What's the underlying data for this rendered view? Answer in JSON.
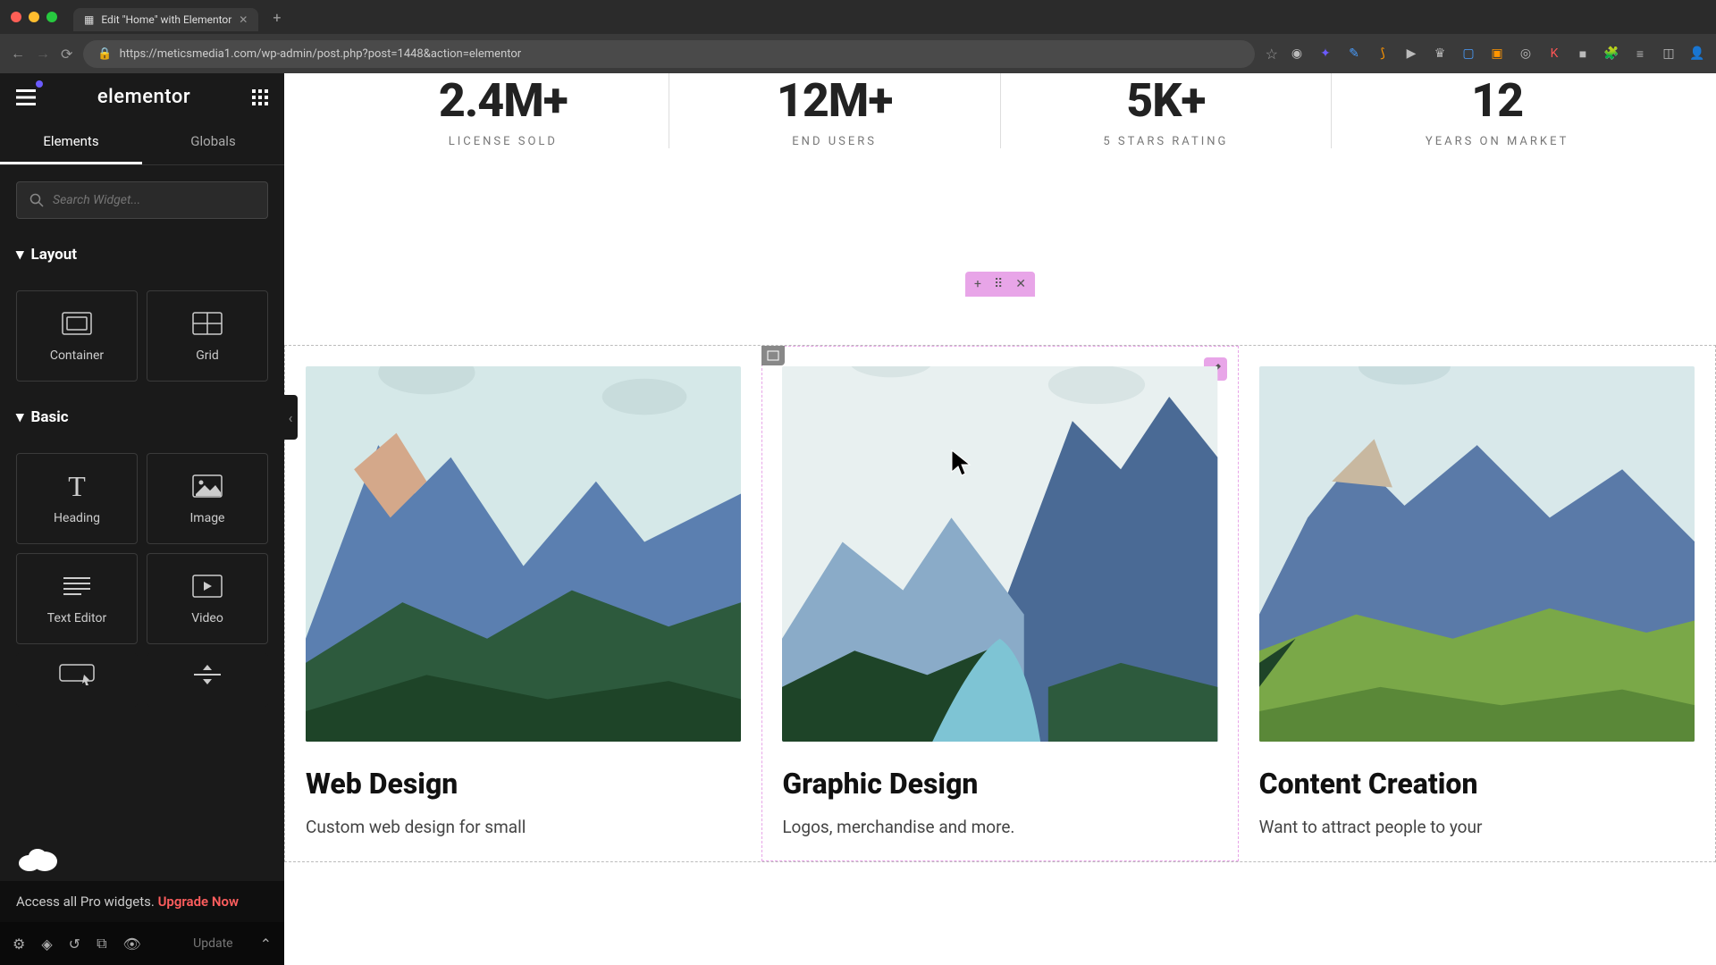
{
  "browser": {
    "tab_title": "Edit \"Home\" with Elementor",
    "url": "https://meticsmedia1.com/wp-admin/post.php?post=1448&action=elementor"
  },
  "sidebar": {
    "logo": "elementor",
    "tabs": [
      "Elements",
      "Globals"
    ],
    "search_placeholder": "Search Widget...",
    "categories": [
      {
        "name": "Layout",
        "widgets": [
          "Container",
          "Grid"
        ]
      },
      {
        "name": "Basic",
        "widgets": [
          "Heading",
          "Image",
          "Text Editor",
          "Video"
        ]
      }
    ],
    "promo_text": "Access all Pro widgets. ",
    "promo_link": "Upgrade Now",
    "update_label": "Update"
  },
  "canvas": {
    "stats": [
      {
        "value": "2.4M+",
        "label": "LICENSE SOLD"
      },
      {
        "value": "12M+",
        "label": "END USERS"
      },
      {
        "value": "5K+",
        "label": "5 STARS RATING"
      },
      {
        "value": "12",
        "label": "YEARS ON MARKET"
      }
    ],
    "cards": [
      {
        "title": "Web Design",
        "desc": "Custom web design for small"
      },
      {
        "title": "Graphic Design",
        "desc": "Logos, merchandise and more."
      },
      {
        "title": "Content Creation",
        "desc": "Want to attract people to your"
      }
    ]
  }
}
